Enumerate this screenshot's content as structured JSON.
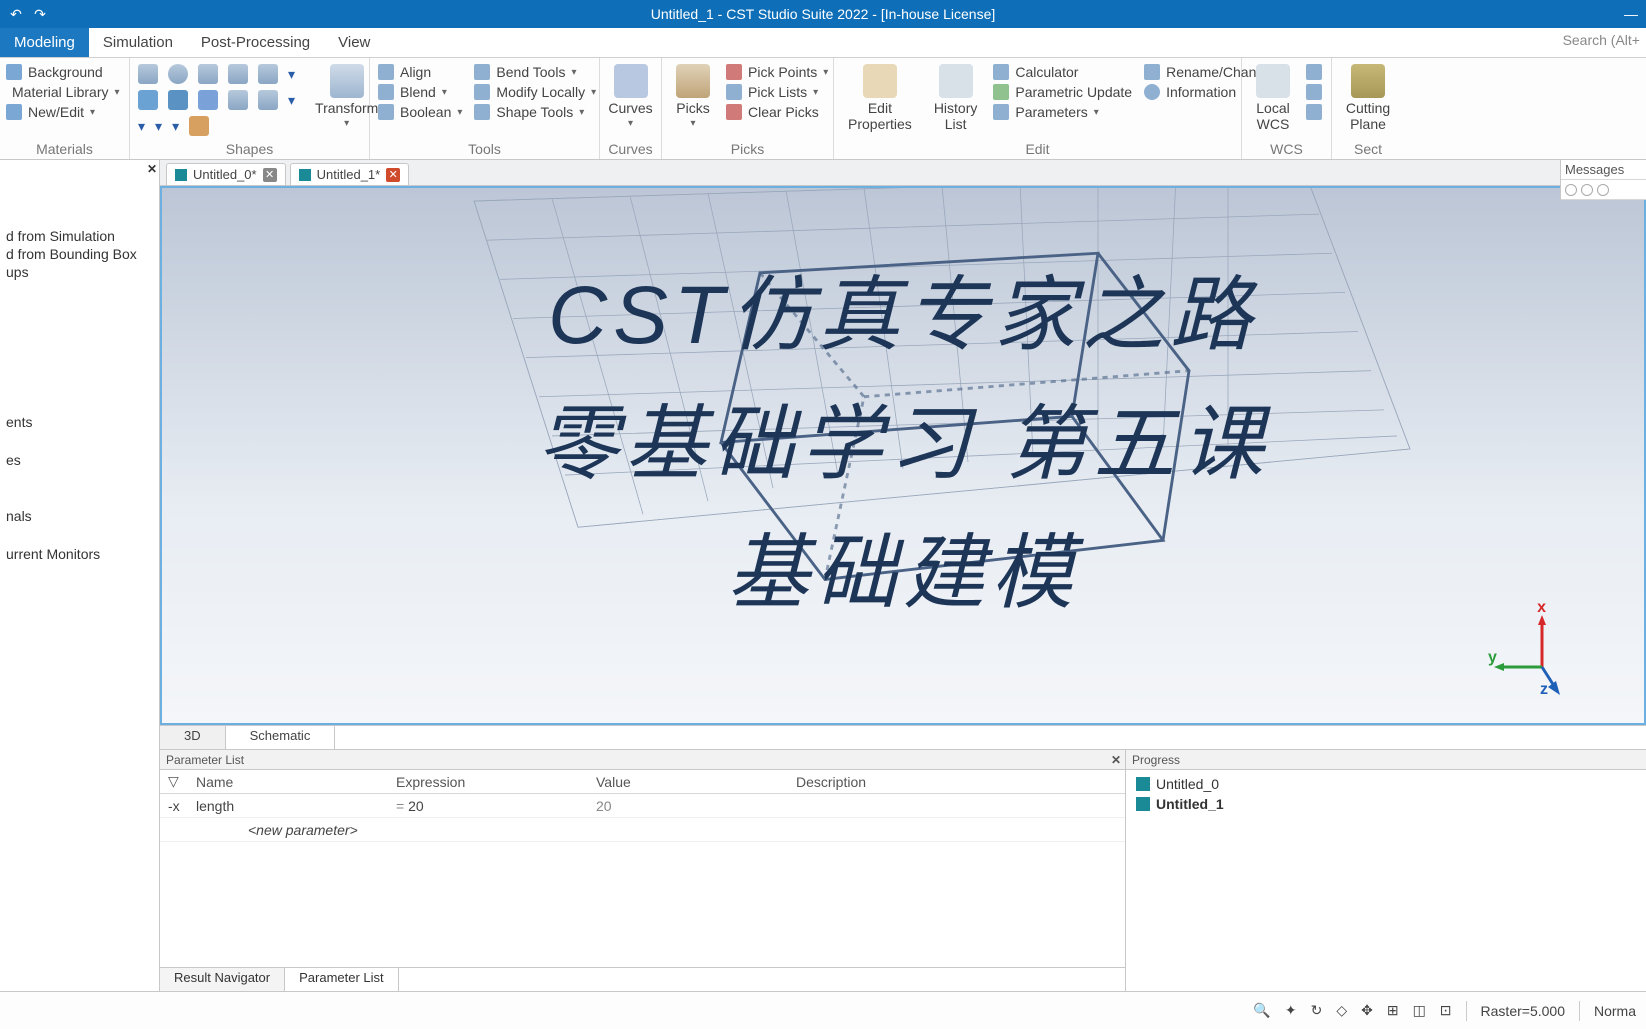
{
  "titlebar": {
    "title": "Untitled_1 - CST Studio Suite 2022 - [In-house License]"
  },
  "menubar": {
    "tabs": [
      "Modeling",
      "Simulation",
      "Post-Processing",
      "View"
    ],
    "search": "Search (Alt+"
  },
  "ribbon": {
    "materials": {
      "label": "Materials",
      "background": "Background",
      "library": "Material Library",
      "newedit": "New/Edit"
    },
    "shapes": {
      "label": "Shapes",
      "transform": "Transform"
    },
    "tools": {
      "label": "Tools",
      "align": "Align",
      "blend": "Blend",
      "boolean": "Boolean",
      "bend": "Bend Tools",
      "modify": "Modify Locally",
      "shape": "Shape Tools"
    },
    "curves": {
      "label": "Curves",
      "curves": "Curves"
    },
    "picks": {
      "label": "Picks",
      "picks": "Picks",
      "pickpoints": "Pick Points",
      "picklists": "Pick Lists",
      "clear": "Clear Picks"
    },
    "edit": {
      "label": "Edit",
      "editprops": "Edit\nProperties",
      "history": "History\nList",
      "calc": "Calculator",
      "paramupdate": "Parametric Update",
      "info": "Information",
      "params": "Parameters",
      "rename": "Rename/Change"
    },
    "wcs": {
      "label": "WCS",
      "local": "Local\nWCS"
    },
    "section": {
      "label": "Sect",
      "cutting": "Cutting\nPlane"
    }
  },
  "leftPane": {
    "items": [
      "d from Simulation",
      "d from Bounding Box",
      "ups"
    ],
    "items2": [
      "ents",
      "es",
      "nals",
      "urrent Monitors"
    ]
  },
  "fileTabs": {
    "t0": "Untitled_0*",
    "t1": "Untitled_1*"
  },
  "overlay": {
    "l1": "CST仿真专家之路",
    "l2": "零基础学习 第五课",
    "l3": "基础建模"
  },
  "axis": {
    "x": "x",
    "y": "y",
    "z": "z"
  },
  "viewTabs": {
    "t3d": "3D",
    "schem": "Schematic"
  },
  "paramList": {
    "title": "Parameter List",
    "cols": {
      "name": "Name",
      "expr": "Expression",
      "val": "Value",
      "desc": "Description"
    },
    "row0": {
      "name": "length",
      "expr": "20",
      "val": "20"
    },
    "new": "<new parameter>"
  },
  "bottomNav": {
    "result": "Result Navigator",
    "param": "Parameter List"
  },
  "progress": {
    "title": "Progress",
    "p0": "Untitled_0",
    "p1": "Untitled_1"
  },
  "messages": {
    "title": "Messages"
  },
  "status": {
    "raster": "Raster=5.000",
    "normal": "Norma"
  }
}
